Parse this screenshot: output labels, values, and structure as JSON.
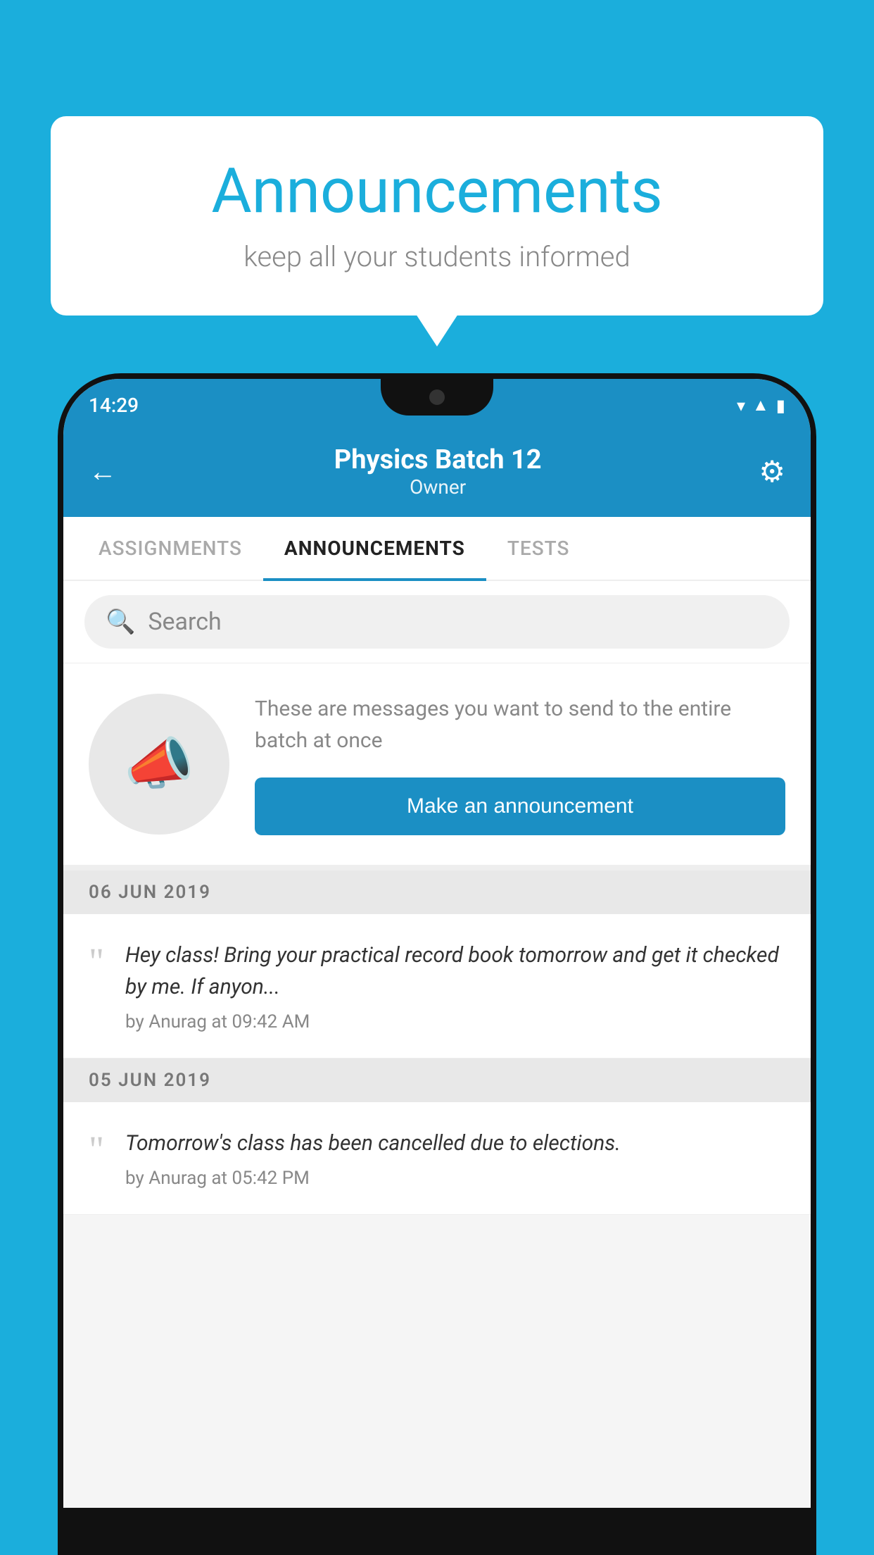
{
  "background_color": "#1BAEDC",
  "speech_bubble": {
    "title": "Announcements",
    "subtitle": "keep all your students informed"
  },
  "phone": {
    "status_bar": {
      "time": "14:29",
      "icons": [
        "wifi",
        "signal",
        "battery"
      ]
    },
    "header": {
      "back_label": "←",
      "title": "Physics Batch 12",
      "subtitle": "Owner",
      "gear_label": "⚙"
    },
    "tabs": [
      {
        "label": "ASSIGNMENTS",
        "active": false
      },
      {
        "label": "ANNOUNCEMENTS",
        "active": true
      },
      {
        "label": "TESTS",
        "active": false
      },
      {
        "label": "...",
        "active": false
      }
    ],
    "search": {
      "placeholder": "Search"
    },
    "promo": {
      "description": "These are messages you want to send to the entire batch at once",
      "button_label": "Make an announcement"
    },
    "announcements": [
      {
        "date": "06  JUN  2019",
        "text": "Hey class! Bring your practical record book tomorrow and get it checked by me. If anyon...",
        "author": "by Anurag at 09:42 AM"
      },
      {
        "date": "05  JUN  2019",
        "text": "Tomorrow's class has been cancelled due to elections.",
        "author": "by Anurag at 05:42 PM"
      }
    ]
  }
}
